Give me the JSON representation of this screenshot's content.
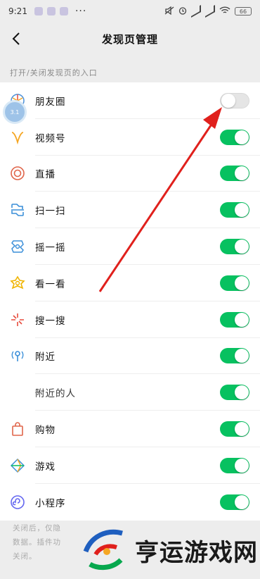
{
  "status": {
    "time": "9:21",
    "more": "···",
    "battery": "66"
  },
  "nav": {
    "title": "发现页管理"
  },
  "section": {
    "label": "打开/关闭发现页的入口"
  },
  "items": [
    {
      "label": "朋友圈",
      "enabled": false,
      "icon": "moments-icon"
    },
    {
      "label": "视频号",
      "enabled": true,
      "icon": "channels-icon"
    },
    {
      "label": "直播",
      "enabled": true,
      "icon": "live-icon"
    },
    {
      "label": "扫一扫",
      "enabled": true,
      "icon": "scan-icon"
    },
    {
      "label": "摇一摇",
      "enabled": true,
      "icon": "shake-icon"
    },
    {
      "label": "看一看",
      "enabled": true,
      "icon": "top-stories-icon"
    },
    {
      "label": "搜一搜",
      "enabled": true,
      "icon": "search-icon"
    },
    {
      "label": "附近",
      "enabled": true,
      "icon": "nearby-icon"
    },
    {
      "label": "附近的人",
      "enabled": true,
      "icon": ""
    },
    {
      "label": "购物",
      "enabled": true,
      "icon": "shopping-icon"
    },
    {
      "label": "游戏",
      "enabled": true,
      "icon": "games-icon"
    },
    {
      "label": "小程序",
      "enabled": true,
      "icon": "mini-programs-icon"
    }
  ],
  "floating_badge": {
    "text": "3.1"
  },
  "footer": {
    "lines": [
      "关闭后，仅隐",
      "数据。插件功",
      "关闭。"
    ]
  },
  "watermark": {
    "text": "亨运游戏网"
  },
  "colors": {
    "toggle_on": "#07c160",
    "toggle_off": "#e5e5e5",
    "annotation_arrow": "#e0201c"
  }
}
